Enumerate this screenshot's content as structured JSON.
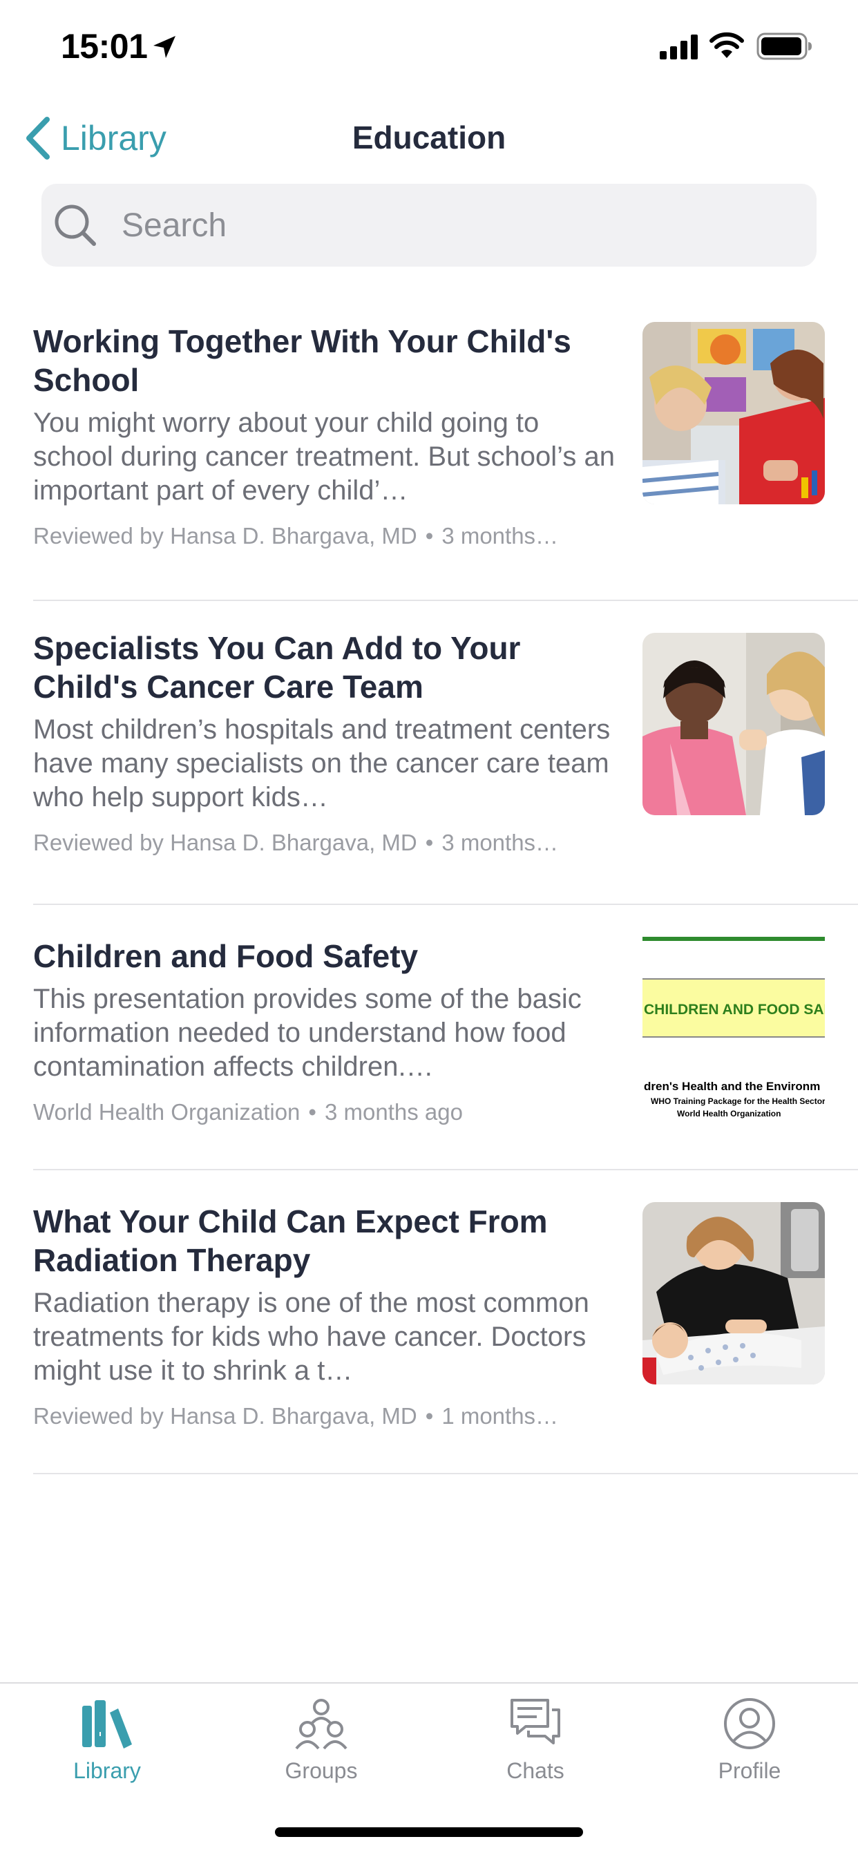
{
  "status_bar": {
    "time": "15:01"
  },
  "nav": {
    "back_label": "Library",
    "title": "Education"
  },
  "search": {
    "placeholder": "Search"
  },
  "articles": [
    {
      "title": "Working Together With Your Child's School",
      "summary": "You might worry about your child going to school during cancer treatment. But school’s an important part of every child’…",
      "source": "Reviewed by Hansa D. Bhargava, MD",
      "date": "3 months…"
    },
    {
      "title": "Specialists You Can Add to Your Child's Cancer Care Team",
      "summary": "Most children’s hospitals and treatment centers have many specialists on the cancer care team who help support kids…",
      "source": "Reviewed by Hansa D. Bhargava, MD",
      "date": "3 months…"
    },
    {
      "title": "Children and Food Safety",
      "summary": "This presentation provides some of the basic information needed to understand how food contamination affects children.…",
      "source": "World Health Organization",
      "date": "3 months ago",
      "thumb_text": {
        "line1": "CHILDREN AND FOOD SAFE",
        "line2": "dren's Health and the Environm",
        "line3": "WHO Training Package for the Health Sector",
        "line4": "World Health Organization"
      }
    },
    {
      "title": "What Your Child Can Expect From Radiation Therapy",
      "summary": "Radiation therapy is one of the most common treatments for kids who have cancer. Doctors might use it to shrink a t…",
      "source": "Reviewed by Hansa D. Bhargava, MD",
      "date": "1 months…"
    }
  ],
  "meta_separator": "•",
  "tabs": [
    {
      "label": "Library",
      "icon": "books-icon",
      "active": true
    },
    {
      "label": "Groups",
      "icon": "groups-icon",
      "active": false
    },
    {
      "label": "Chats",
      "icon": "chats-icon",
      "active": false
    },
    {
      "label": "Profile",
      "icon": "profile-icon",
      "active": false
    }
  ],
  "colors": {
    "accent": "#3a9eae",
    "title_text": "#252b3d",
    "body_text": "#6c6e76",
    "meta_text": "#9a9ca2",
    "inactive_tab": "#8a8c92"
  }
}
